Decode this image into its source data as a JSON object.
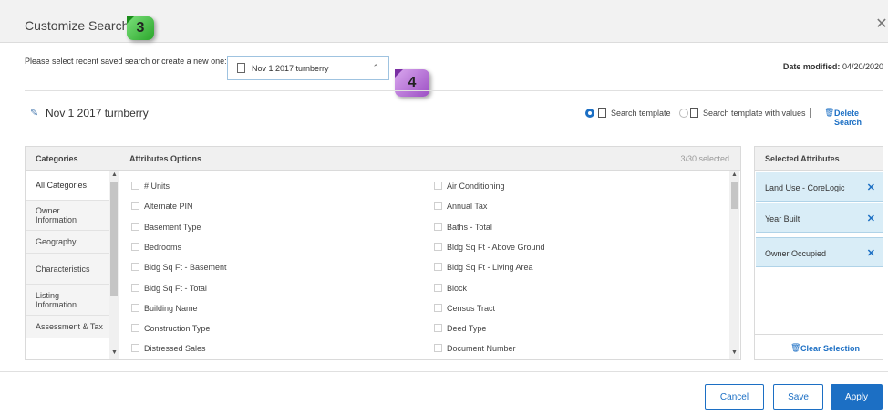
{
  "header": {
    "title": "Customize Search",
    "close_icon": "close-icon"
  },
  "badges": {
    "step3": "3",
    "step4": "4"
  },
  "toolbar": {
    "select_prompt": "Please select recent saved search or create a new one:",
    "saved_search_value": "Nov 1 2017 turnberry",
    "date_modified_label": "Date modified:",
    "date_modified_value": "04/20/2020"
  },
  "search": {
    "name": "Nov 1 2017 turnberry",
    "option_template": "Search template",
    "option_template_values": "Search template with values",
    "delete_label": "Delete Search",
    "selected_option": "Search template"
  },
  "categories": {
    "header": "Categories",
    "items": [
      {
        "label": "All Categories"
      },
      {
        "label": "Owner\nInformation"
      },
      {
        "label": "Geography"
      },
      {
        "label": "Characteristics"
      },
      {
        "label": "Listing\nInformation"
      },
      {
        "label": "Assessment & Tax"
      }
    ],
    "active_index": 0
  },
  "attributes": {
    "header": "Attributes Options",
    "count": "3/30 selected",
    "left": [
      "# Units",
      "Alternate PIN",
      "Basement Type",
      "Bedrooms",
      "Bldg Sq Ft - Basement",
      "Bldg Sq Ft - Total",
      "Building Name",
      "Construction Type",
      "Distressed Sales"
    ],
    "right": [
      "Air Conditioning",
      "Annual Tax",
      "Baths - Total",
      "Bldg Sq Ft - Above Ground",
      "Bldg Sq Ft - Living Area",
      "Block",
      "Census Tract",
      "Deed Type",
      "Document Number"
    ]
  },
  "selected": {
    "header": "Selected Attributes",
    "items": [
      "Land Use - CoreLogic",
      "Year Built",
      "Owner Occupied"
    ],
    "clear_label": "Clear Selection"
  },
  "footer": {
    "cancel": "Cancel",
    "save": "Save",
    "apply": "Apply"
  },
  "colors": {
    "accent": "#1c6fc4",
    "chip_bg": "#d9edf7",
    "badge3": "#3cbf3c",
    "badge4": "#b56dd8"
  }
}
